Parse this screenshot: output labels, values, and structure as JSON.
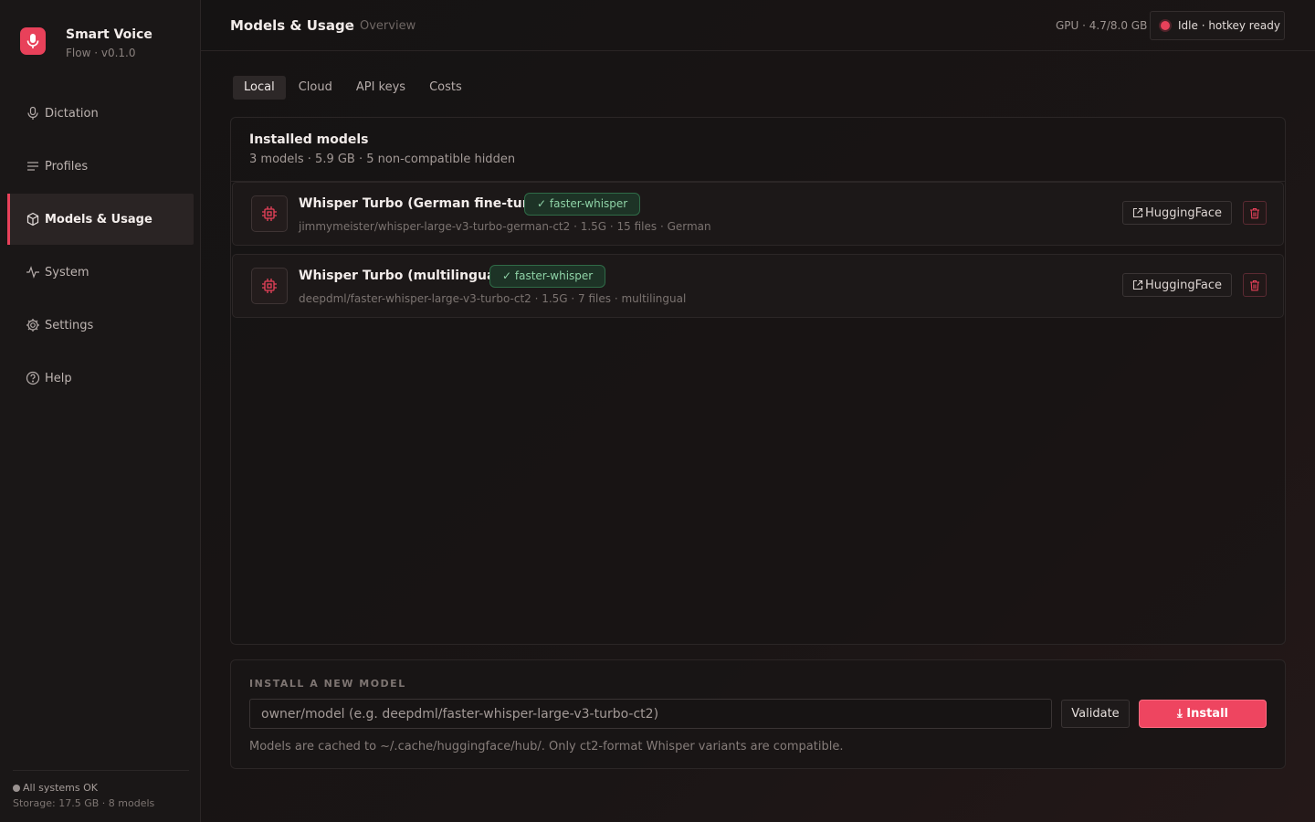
{
  "brand": {
    "title": "Smart Voice",
    "subtitle": "Flow · v0.1.0"
  },
  "sidebar": {
    "items": [
      {
        "label": "Dictation",
        "icon": "mic-icon",
        "active": false
      },
      {
        "label": "Profiles",
        "icon": "list-icon",
        "active": false
      },
      {
        "label": "Models & Usage",
        "icon": "cube-icon",
        "active": true
      },
      {
        "label": "System",
        "icon": "activity-icon",
        "active": false
      },
      {
        "label": "Settings",
        "icon": "gear-icon",
        "active": false
      },
      {
        "label": "Help",
        "icon": "help-icon",
        "active": false
      }
    ],
    "footer": {
      "status": "All systems OK",
      "storage": "Storage: 17.5 GB · 8 models"
    }
  },
  "header": {
    "title": "Models & Usage",
    "separator": "·",
    "crumb": "Overview",
    "gpu": "GPU · 4.7/8.0 GB",
    "status": "Idle · hotkey ready"
  },
  "tabs": [
    {
      "label": "Local",
      "active": true
    },
    {
      "label": "Cloud",
      "active": false
    },
    {
      "label": "API keys",
      "active": false
    },
    {
      "label": "Costs",
      "active": false
    }
  ],
  "installed": {
    "title": "Installed models",
    "summary": "3 models · 5.9 GB · 5 non-compatible hidden",
    "models": [
      {
        "name": "Whisper Turbo (German fine-tune)",
        "badge": "✓ faster-whisper",
        "meta": "jimmymeister/whisper-large-v3-turbo-german-ct2  ·  1.5G  ·  15 files  ·  German",
        "hf_label": "HuggingFace"
      },
      {
        "name": "Whisper Turbo (multilingual)",
        "badge": "✓ faster-whisper",
        "meta": "deepdml/faster-whisper-large-v3-turbo-ct2  ·  1.5G  ·  7 files  ·  multilingual",
        "hf_label": "HuggingFace"
      }
    ]
  },
  "install": {
    "title": "INSTALL A NEW MODEL",
    "placeholder": "owner/model (e.g. deepdml/faster-whisper-large-v3-turbo-ct2)",
    "validate_label": "Validate",
    "install_label": "⤓ Install",
    "note": "Models are cached to ~/.cache/huggingface/hub/. Only ct2-format Whisper variants are compatible."
  },
  "colors": {
    "accent": "#e8415a",
    "badge_green": "#8fd3a7"
  }
}
